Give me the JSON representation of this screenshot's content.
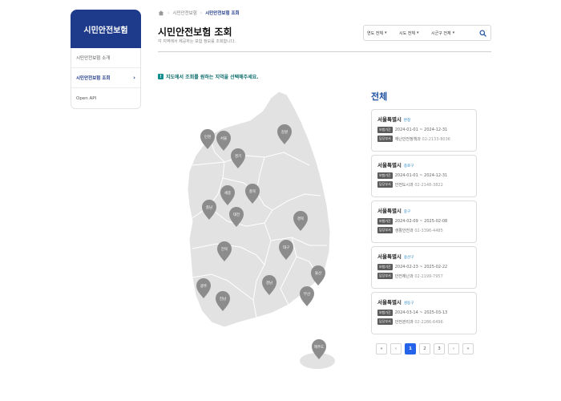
{
  "sidebar": {
    "title": "시민안전보험",
    "items": [
      {
        "label": "시민안전보험 소개",
        "active": false
      },
      {
        "label": "시민안전보험 조회",
        "active": true
      },
      {
        "label": "Open API",
        "active": false
      }
    ]
  },
  "breadcrumb": {
    "items": [
      "시민안전보험",
      "시민안전보험 조회"
    ]
  },
  "page": {
    "title": "시민안전보험 조회",
    "description": "각 지역에서 제공하는 보험 정보를 조회합니다."
  },
  "filters": {
    "year": "연도 전체",
    "province": "시도 전체",
    "district": "시군구 전체"
  },
  "instruction": "지도에서 조회를 원하는 지역을 선택해주세요.",
  "map": {
    "fill_color": "#e2e2e2",
    "pin_color": "#8c8c8c",
    "pins": [
      "인천",
      "서울",
      "경기",
      "강원",
      "세종",
      "충북",
      "충남",
      "대전",
      "경북",
      "대구",
      "전북",
      "울산",
      "경남",
      "광주",
      "전남",
      "부산",
      "제주도"
    ]
  },
  "list": {
    "title": "전체",
    "period_tag": "보험기간",
    "dept_tag": "담당부서",
    "cards": [
      {
        "city": "서울특별시",
        "district": "본청",
        "period": "2024-01-01 ~ 2024-12-31",
        "dept": "재난안전정책과",
        "phone": "02-2133-8036"
      },
      {
        "city": "서울특별시",
        "district": "종로구",
        "period": "2024-01-01 ~ 2024-12-31",
        "dept": "안전도시과",
        "phone": "02-2148-3822"
      },
      {
        "city": "서울특별시",
        "district": "중구",
        "period": "2024-02-09 ~ 2025-02-08",
        "dept": "생활안전과",
        "phone": "02-3396-4485"
      },
      {
        "city": "서울특별시",
        "district": "용산구",
        "period": "2024-02-23 ~ 2025-02-22",
        "dept": "안전재난과",
        "phone": "02-2199-7957"
      },
      {
        "city": "서울특별시",
        "district": "성동구",
        "period": "2024-03-14 ~ 2025-03-13",
        "dept": "안전관리과",
        "phone": "02-2286-6496"
      }
    ]
  },
  "pagination": {
    "first": "«",
    "prev": "‹",
    "pages": [
      "1",
      "2",
      "3"
    ],
    "current": "1",
    "next": "›",
    "last": "»"
  },
  "colors": {
    "brand": "#1e3a8a",
    "accent": "#2563eb",
    "title_blue": "#1e4fa0"
  }
}
